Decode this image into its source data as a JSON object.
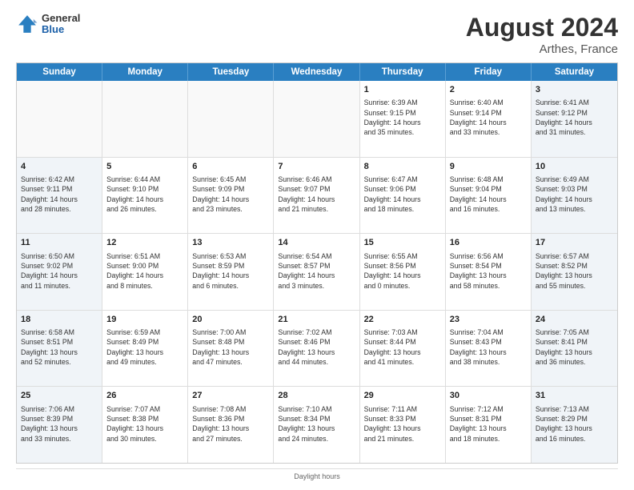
{
  "logo": {
    "line1": "General",
    "line2": "Blue"
  },
  "title": "August 2024",
  "subtitle": "Arthes, France",
  "days_of_week": [
    "Sunday",
    "Monday",
    "Tuesday",
    "Wednesday",
    "Thursday",
    "Friday",
    "Saturday"
  ],
  "footer": "Daylight hours",
  "weeks": [
    [
      {
        "day": "",
        "empty": true
      },
      {
        "day": "",
        "empty": true
      },
      {
        "day": "",
        "empty": true
      },
      {
        "day": "",
        "empty": true
      },
      {
        "day": "1",
        "lines": [
          "Sunrise: 6:39 AM",
          "Sunset: 9:15 PM",
          "Daylight: 14 hours",
          "and 35 minutes."
        ]
      },
      {
        "day": "2",
        "lines": [
          "Sunrise: 6:40 AM",
          "Sunset: 9:14 PM",
          "Daylight: 14 hours",
          "and 33 minutes."
        ]
      },
      {
        "day": "3",
        "lines": [
          "Sunrise: 6:41 AM",
          "Sunset: 9:12 PM",
          "Daylight: 14 hours",
          "and 31 minutes."
        ]
      }
    ],
    [
      {
        "day": "4",
        "lines": [
          "Sunrise: 6:42 AM",
          "Sunset: 9:11 PM",
          "Daylight: 14 hours",
          "and 28 minutes."
        ]
      },
      {
        "day": "5",
        "lines": [
          "Sunrise: 6:44 AM",
          "Sunset: 9:10 PM",
          "Daylight: 14 hours",
          "and 26 minutes."
        ]
      },
      {
        "day": "6",
        "lines": [
          "Sunrise: 6:45 AM",
          "Sunset: 9:09 PM",
          "Daylight: 14 hours",
          "and 23 minutes."
        ]
      },
      {
        "day": "7",
        "lines": [
          "Sunrise: 6:46 AM",
          "Sunset: 9:07 PM",
          "Daylight: 14 hours",
          "and 21 minutes."
        ]
      },
      {
        "day": "8",
        "lines": [
          "Sunrise: 6:47 AM",
          "Sunset: 9:06 PM",
          "Daylight: 14 hours",
          "and 18 minutes."
        ]
      },
      {
        "day": "9",
        "lines": [
          "Sunrise: 6:48 AM",
          "Sunset: 9:04 PM",
          "Daylight: 14 hours",
          "and 16 minutes."
        ]
      },
      {
        "day": "10",
        "lines": [
          "Sunrise: 6:49 AM",
          "Sunset: 9:03 PM",
          "Daylight: 14 hours",
          "and 13 minutes."
        ]
      }
    ],
    [
      {
        "day": "11",
        "lines": [
          "Sunrise: 6:50 AM",
          "Sunset: 9:02 PM",
          "Daylight: 14 hours",
          "and 11 minutes."
        ]
      },
      {
        "day": "12",
        "lines": [
          "Sunrise: 6:51 AM",
          "Sunset: 9:00 PM",
          "Daylight: 14 hours",
          "and 8 minutes."
        ]
      },
      {
        "day": "13",
        "lines": [
          "Sunrise: 6:53 AM",
          "Sunset: 8:59 PM",
          "Daylight: 14 hours",
          "and 6 minutes."
        ]
      },
      {
        "day": "14",
        "lines": [
          "Sunrise: 6:54 AM",
          "Sunset: 8:57 PM",
          "Daylight: 14 hours",
          "and 3 minutes."
        ]
      },
      {
        "day": "15",
        "lines": [
          "Sunrise: 6:55 AM",
          "Sunset: 8:56 PM",
          "Daylight: 14 hours",
          "and 0 minutes."
        ]
      },
      {
        "day": "16",
        "lines": [
          "Sunrise: 6:56 AM",
          "Sunset: 8:54 PM",
          "Daylight: 13 hours",
          "and 58 minutes."
        ]
      },
      {
        "day": "17",
        "lines": [
          "Sunrise: 6:57 AM",
          "Sunset: 8:52 PM",
          "Daylight: 13 hours",
          "and 55 minutes."
        ]
      }
    ],
    [
      {
        "day": "18",
        "lines": [
          "Sunrise: 6:58 AM",
          "Sunset: 8:51 PM",
          "Daylight: 13 hours",
          "and 52 minutes."
        ]
      },
      {
        "day": "19",
        "lines": [
          "Sunrise: 6:59 AM",
          "Sunset: 8:49 PM",
          "Daylight: 13 hours",
          "and 49 minutes."
        ]
      },
      {
        "day": "20",
        "lines": [
          "Sunrise: 7:00 AM",
          "Sunset: 8:48 PM",
          "Daylight: 13 hours",
          "and 47 minutes."
        ]
      },
      {
        "day": "21",
        "lines": [
          "Sunrise: 7:02 AM",
          "Sunset: 8:46 PM",
          "Daylight: 13 hours",
          "and 44 minutes."
        ]
      },
      {
        "day": "22",
        "lines": [
          "Sunrise: 7:03 AM",
          "Sunset: 8:44 PM",
          "Daylight: 13 hours",
          "and 41 minutes."
        ]
      },
      {
        "day": "23",
        "lines": [
          "Sunrise: 7:04 AM",
          "Sunset: 8:43 PM",
          "Daylight: 13 hours",
          "and 38 minutes."
        ]
      },
      {
        "day": "24",
        "lines": [
          "Sunrise: 7:05 AM",
          "Sunset: 8:41 PM",
          "Daylight: 13 hours",
          "and 36 minutes."
        ]
      }
    ],
    [
      {
        "day": "25",
        "lines": [
          "Sunrise: 7:06 AM",
          "Sunset: 8:39 PM",
          "Daylight: 13 hours",
          "and 33 minutes."
        ]
      },
      {
        "day": "26",
        "lines": [
          "Sunrise: 7:07 AM",
          "Sunset: 8:38 PM",
          "Daylight: 13 hours",
          "and 30 minutes."
        ]
      },
      {
        "day": "27",
        "lines": [
          "Sunrise: 7:08 AM",
          "Sunset: 8:36 PM",
          "Daylight: 13 hours",
          "and 27 minutes."
        ]
      },
      {
        "day": "28",
        "lines": [
          "Sunrise: 7:10 AM",
          "Sunset: 8:34 PM",
          "Daylight: 13 hours",
          "and 24 minutes."
        ]
      },
      {
        "day": "29",
        "lines": [
          "Sunrise: 7:11 AM",
          "Sunset: 8:33 PM",
          "Daylight: 13 hours",
          "and 21 minutes."
        ]
      },
      {
        "day": "30",
        "lines": [
          "Sunrise: 7:12 AM",
          "Sunset: 8:31 PM",
          "Daylight: 13 hours",
          "and 18 minutes."
        ]
      },
      {
        "day": "31",
        "lines": [
          "Sunrise: 7:13 AM",
          "Sunset: 8:29 PM",
          "Daylight: 13 hours",
          "and 16 minutes."
        ]
      }
    ]
  ]
}
